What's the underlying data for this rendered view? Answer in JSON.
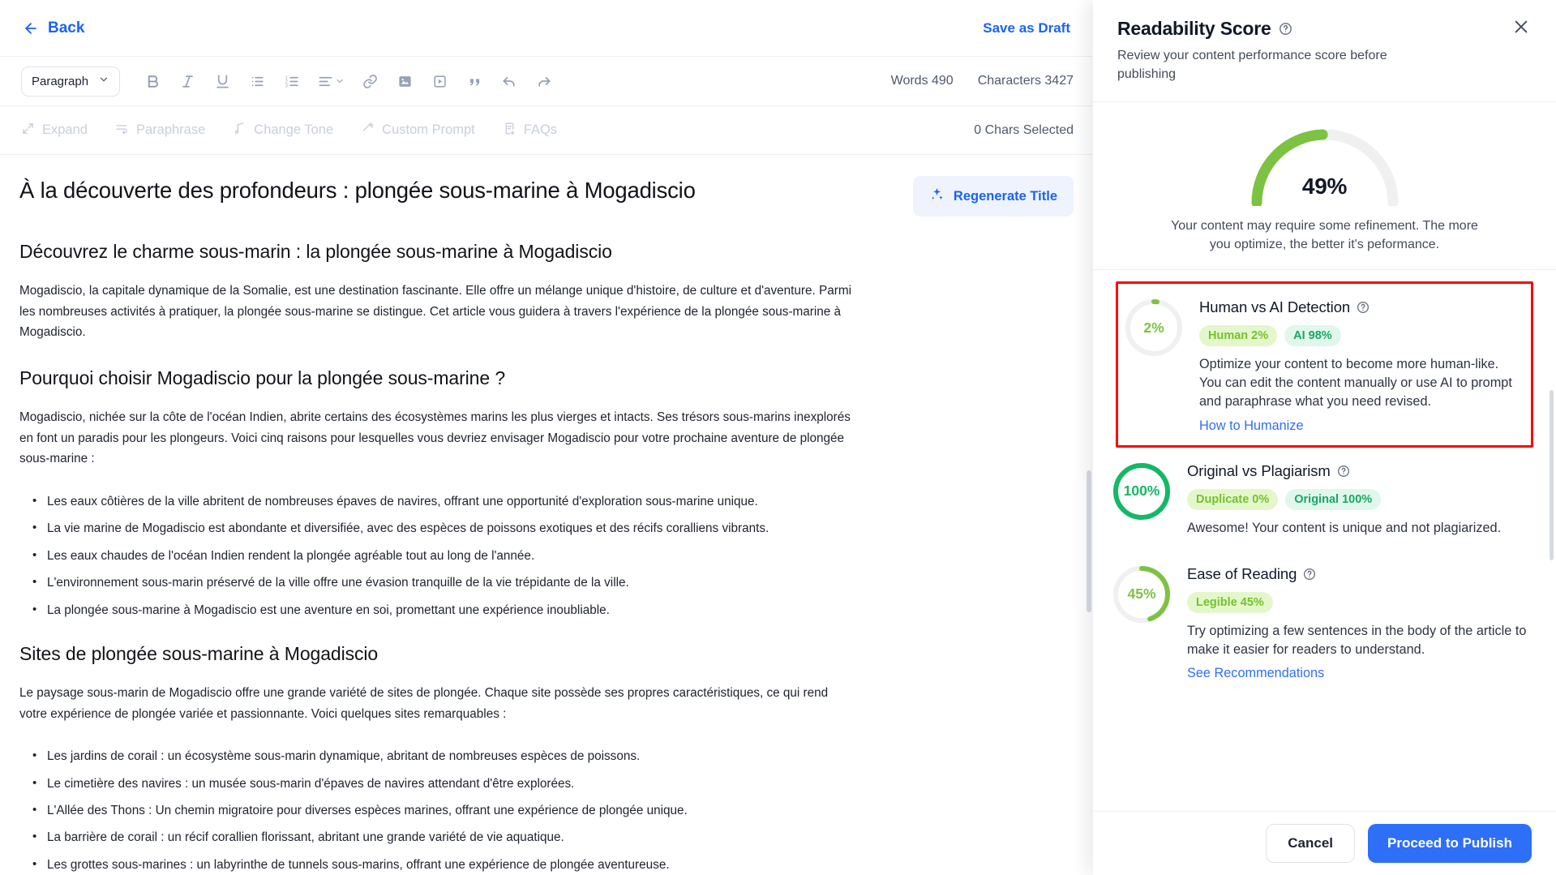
{
  "editor": {
    "back_label": "Back",
    "save_draft_label": "Save as Draft",
    "toolbar": {
      "block_format": "Paragraph",
      "words_label": "Words 490",
      "characters_label": "Characters 3427",
      "icons": [
        "bold-icon",
        "italic-icon",
        "underline-icon",
        "bullet-list-icon",
        "numbered-list-icon",
        "align-left-icon",
        "link-icon",
        "image-icon",
        "video-icon",
        "blockquote-icon",
        "undo-icon",
        "redo-icon"
      ]
    },
    "ai_toolbar": {
      "items": [
        {
          "label": "Expand",
          "icon": "expand-icon"
        },
        {
          "label": "Paraphrase",
          "icon": "paraphrase-icon"
        },
        {
          "label": "Change Tone",
          "icon": "music-note-icon"
        },
        {
          "label": "Custom Prompt",
          "icon": "magic-wand-icon"
        },
        {
          "label": "FAQs",
          "icon": "faq-document-icon"
        }
      ],
      "chars_selected": "0 Chars Selected"
    },
    "document": {
      "title": "À la découverte des profondeurs : plongée sous-marine à Mogadiscio",
      "regenerate_title_label": "Regenerate Title",
      "sections": [
        {
          "heading": "Découvrez le charme sous-marin : la plongée sous-marine à Mogadiscio",
          "paragraph": "Mogadiscio, la capitale dynamique de la Somalie, est une destination fascinante. Elle offre un mélange unique d'histoire, de culture et d'aventure. Parmi les nombreuses activités à pratiquer, la plongée sous-marine se distingue. Cet article vous guidera à travers l'expérience de la plongée sous-marine à Mogadiscio."
        },
        {
          "heading": "Pourquoi choisir Mogadiscio pour la plongée sous-marine ?",
          "paragraph": "Mogadiscio, nichée sur la côte de l'océan Indien, abrite certains des écosystèmes marins les plus vierges et intacts. Ses trésors sous-marins inexplorés en font un paradis pour les plongeurs. Voici cinq raisons pour lesquelles vous devriez envisager Mogadiscio pour votre prochaine aventure de plongée sous-marine :",
          "bullets": [
            "Les eaux côtières de la ville abritent de nombreuses épaves de navires, offrant une opportunité d'exploration sous-marine unique.",
            "La vie marine de Mogadiscio est abondante et diversifiée, avec des espèces de poissons exotiques et des récifs coralliens vibrants.",
            "Les eaux chaudes de l'océan Indien rendent la plongée agréable tout au long de l'année.",
            "L'environnement sous-marin préservé de la ville offre une évasion tranquille de la vie trépidante de la ville.",
            "La plongée sous-marine à Mogadiscio est une aventure en soi, promettant une expérience inoubliable."
          ]
        },
        {
          "heading": "Sites de plongée sous-marine à Mogadiscio",
          "paragraph": "Le paysage sous-marin de Mogadiscio offre une grande variété de sites de plongée. Chaque site possède ses propres caractéristiques, ce qui rend votre expérience de plongée variée et passionnante. Voici quelques sites remarquables :",
          "bullets": [
            "Les jardins de corail : un écosystème sous-marin dynamique, abritant de nombreuses espèces de poissons.",
            "Le cimetière des navires : un musée sous-marin d'épaves de navires attendant d'être explorées.",
            "L'Allée des Thons : Un chemin migratoire pour diverses espèces marines, offrant une expérience de plongée unique.",
            "La barrière de corail : un récif corallien florissant, abritant une grande variété de vie aquatique.",
            "Les grottes sous-marines : un labyrinthe de tunnels sous-marins, offrant une expérience de plongée aventureuse."
          ]
        }
      ]
    }
  },
  "panel": {
    "title": "Readability Score",
    "subtitle": "Review your content performance score before publishing",
    "close_icon": "close-icon",
    "help_icon": "help-circle-icon",
    "gauge": {
      "value_label": "49%",
      "value": 49,
      "note": "Your content may require some refinement. The more you optimize, the better it's peformance.",
      "arc_color": "#7DC242",
      "track_color": "#F0F0F0"
    },
    "metrics": [
      {
        "name": "human-vs-ai-detection",
        "title": "Human vs AI Detection",
        "ring_label": "2%",
        "ring_value": 2,
        "ring_color": "#7DC242",
        "highlighted": true,
        "pills": [
          {
            "text": "Human 2%",
            "style": "lime"
          },
          {
            "text": "AI 98%",
            "style": "mint"
          }
        ],
        "description": "Optimize your content to become more human-like. You can edit the content manually or use AI to prompt and paraphrase what you need revised.",
        "link": "How to Humanize"
      },
      {
        "name": "original-vs-plagiarism",
        "title": "Original vs Plagiarism",
        "ring_label": "100%",
        "ring_value": 100,
        "ring_color": "#14B866",
        "highlighted": false,
        "pills": [
          {
            "text": "Duplicate 0%",
            "style": "lime"
          },
          {
            "text": "Original 100%",
            "style": "mint"
          }
        ],
        "description": "Awesome! Your content is unique and not plagiarized.",
        "link": ""
      },
      {
        "name": "ease-of-reading",
        "title": "Ease of Reading",
        "ring_label": "45%",
        "ring_value": 45,
        "ring_color": "#7DC242",
        "highlighted": false,
        "pills": [
          {
            "text": "Legible 45%",
            "style": "lime"
          }
        ],
        "description": "Try optimizing a few sentences in the body of the article to make it easier for readers to understand.",
        "link": "See Recommendations"
      }
    ],
    "footer": {
      "cancel_label": "Cancel",
      "publish_label": "Proceed to Publish"
    }
  },
  "colors": {
    "accent_blue": "#2D6FF7",
    "link_blue": "#1A63F5",
    "highlight_red": "#FF0000",
    "green_light": "#7DC242",
    "green_dark": "#14B866"
  }
}
